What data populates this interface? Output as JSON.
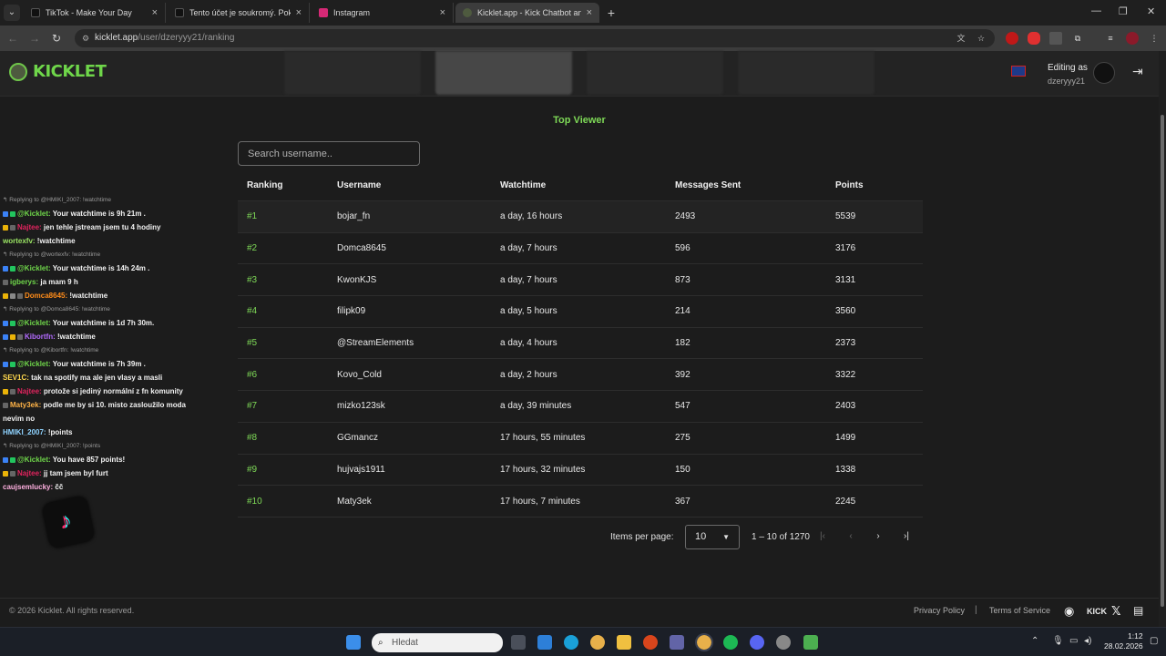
{
  "browser": {
    "tabs": [
      {
        "label": "TikTok - Make Your Day",
        "color": "#111111"
      },
      {
        "label": "Tento účet je soukromý. Pokud",
        "color": "#111111"
      },
      {
        "label": "Instagram",
        "color": "#d62976"
      },
      {
        "label": "Kicklet.app - Kick Chatbot and I",
        "color": "#4e5a3f"
      }
    ],
    "url_host": "kicklet.app",
    "url_path": "/user/dzeryyy21/ranking"
  },
  "header": {
    "logo": "KICKLET",
    "editing_label": "Editing as",
    "editing_user": "dzeryyy21"
  },
  "ranking": {
    "title": "Top Viewer",
    "search_placeholder": "Search username..",
    "columns": [
      "Ranking",
      "Username",
      "Watchtime",
      "Messages Sent",
      "Points"
    ],
    "rows": [
      {
        "rank": "#1",
        "username": "bojar_fn",
        "watchtime": "a day, 16 hours",
        "messages": "2493",
        "points": "5539"
      },
      {
        "rank": "#2",
        "username": "Domca8645",
        "watchtime": "a day, 7 hours",
        "messages": "596",
        "points": "3176"
      },
      {
        "rank": "#3",
        "username": "KwonKJS",
        "watchtime": "a day, 7 hours",
        "messages": "873",
        "points": "3131"
      },
      {
        "rank": "#4",
        "username": "filipk09",
        "watchtime": "a day, 5 hours",
        "messages": "214",
        "points": "3560"
      },
      {
        "rank": "#5",
        "username": "@StreamElements",
        "watchtime": "a day, 4 hours",
        "messages": "182",
        "points": "2373"
      },
      {
        "rank": "#6",
        "username": "Kovo_Cold",
        "watchtime": "a day, 2 hours",
        "messages": "392",
        "points": "3322"
      },
      {
        "rank": "#7",
        "username": "mizko123sk",
        "watchtime": "a day, 39 minutes",
        "messages": "547",
        "points": "2403"
      },
      {
        "rank": "#8",
        "username": "GGmancz",
        "watchtime": "17 hours, 55 minutes",
        "messages": "275",
        "points": "1499"
      },
      {
        "rank": "#9",
        "username": "hujvajs1911",
        "watchtime": "17 hours, 32 minutes",
        "messages": "150",
        "points": "1338"
      },
      {
        "rank": "#10",
        "username": "Maty3ek",
        "watchtime": "17 hours, 7 minutes",
        "messages": "367",
        "points": "2245"
      }
    ],
    "pagination": {
      "label": "Items per page:",
      "per_page": "10",
      "range": "1 – 10 of 1270"
    }
  },
  "chat": [
    {
      "type": "reply",
      "text": "Replying to @HMIKI_2007: !watchtime"
    },
    {
      "user": "@Kicklet:",
      "color": "#6fd64a",
      "text": "Your watchtime is 9h 21m ."
    },
    {
      "user": "Najtee:",
      "color": "#e0245e",
      "text": "jen tehle jstream jsem tu 4 hodiny"
    },
    {
      "user": "wortexfv:",
      "color": "#9be564",
      "text": "!watchtime"
    },
    {
      "type": "reply",
      "text": "Replying to @wortexfv: !watchtime"
    },
    {
      "user": "@Kicklet:",
      "color": "#6fd64a",
      "text": "Your watchtime is 14h 24m ."
    },
    {
      "user": "igberys:",
      "color": "#6fd64a",
      "text": "ja mam 9 h"
    },
    {
      "user": "Domca8645:",
      "color": "#ff8c1a",
      "text": "!watchtime"
    },
    {
      "type": "reply",
      "text": "Replying to @Domca8645: !watchtime"
    },
    {
      "user": "@Kicklet:",
      "color": "#6fd64a",
      "text": "Your watchtime is 1d 7h 30m."
    },
    {
      "user": "Kibortfn:",
      "color": "#b36bff",
      "text": "!watchtime"
    },
    {
      "type": "reply",
      "text": "Replying to @Kibortfn: !watchtime"
    },
    {
      "user": "@Kicklet:",
      "color": "#6fd64a",
      "text": "Your watchtime is 7h 39m ."
    },
    {
      "user": "SEV1C:",
      "color": "#ffd84d",
      "text": "tak na spotify ma ale jen vlasy a masli"
    },
    {
      "user": "Najtee:",
      "color": "#e0245e",
      "text": "protože si jediný normální z fn komunity"
    },
    {
      "user": "Maty3ek:",
      "color": "#ffb347",
      "text": "podle me by si 10. misto zasloužilo moda"
    },
    {
      "user": "",
      "color": "#f2f2f2",
      "text": "nevim no"
    },
    {
      "user": "HMIKI_2007:",
      "color": "#8fd3ff",
      "text": "!points"
    },
    {
      "type": "reply",
      "text": "Replying to @HMIKI_2007: !points"
    },
    {
      "user": "@Kicklet:",
      "color": "#6fd64a",
      "text": "You have 857 points!"
    },
    {
      "user": "Najtee:",
      "color": "#e0245e",
      "text": "jj tam jsem byl furt"
    },
    {
      "user": "caujsemlucky:",
      "color": "#ffb0e0",
      "text": "čč"
    }
  ],
  "footer": {
    "copyright": "© 2026 Kicklet. All rights reserved.",
    "privacy": "Privacy Policy",
    "separator": "|",
    "terms": "Terms of Service",
    "kick": "KICK"
  },
  "taskbar": {
    "search_placeholder": "Hledat",
    "time": "1:12",
    "date": "28.02.2026"
  }
}
